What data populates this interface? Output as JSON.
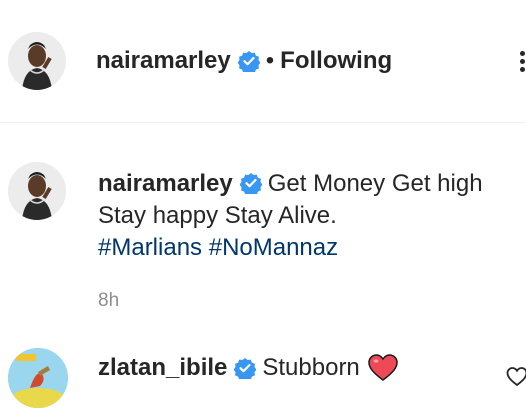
{
  "post_header": {
    "username": "nairamarley",
    "separator": "•",
    "follow_status": "Following"
  },
  "caption": {
    "username": "nairamarley",
    "text_line1": "Get Money Get high",
    "text_line2": "Stay happy Stay Alive.",
    "hashtags": [
      "#Marlians",
      "#NoMannaz"
    ],
    "time": "8h"
  },
  "comment": {
    "username": "zlatan_ibile",
    "text": "Stubborn",
    "emoji": "heart-emoji"
  },
  "colors": {
    "text": "#262626",
    "hashtag": "#00376b",
    "verified": "#3897f0",
    "muted": "#8e8e8e",
    "heart": "#ed4956"
  }
}
